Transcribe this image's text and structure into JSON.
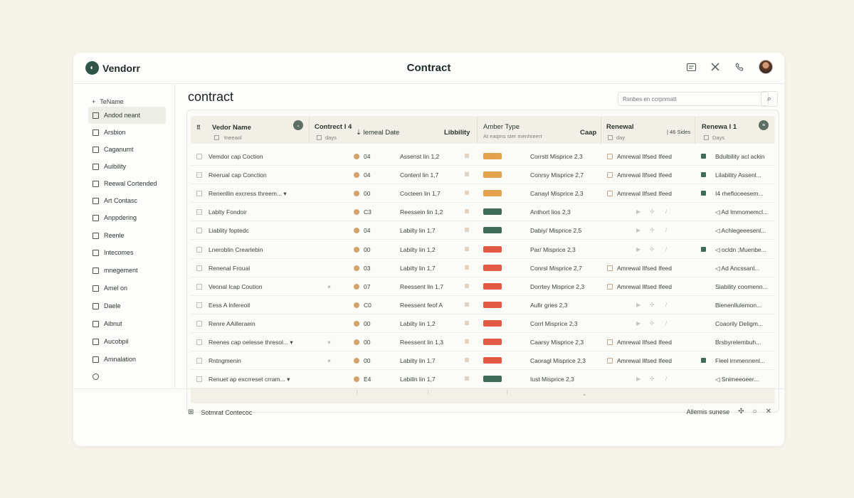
{
  "app": {
    "logo_text": "Vendorr",
    "title": "Contract"
  },
  "colors": {
    "accent": "#2f5548",
    "orange": "#e3a24b",
    "red": "#e25a43",
    "green": "#3f6b5b",
    "background": "#f6f3ea"
  },
  "topbar_icons": [
    "window-icon",
    "tools-icon",
    "phone-icon"
  ],
  "sidebar": {
    "header": "TeName",
    "items": [
      {
        "label": "Andod neant",
        "active": true
      },
      {
        "label": "Arsbion"
      },
      {
        "label": "Caganumt"
      },
      {
        "label": "Auibility"
      },
      {
        "label": "Reewal Cortended"
      },
      {
        "label": "Art Contasc"
      },
      {
        "label": "Anppdering"
      },
      {
        "label": "Reenle"
      },
      {
        "label": "Intecomes"
      },
      {
        "label": "mnegement"
      },
      {
        "label": "Amel on"
      },
      {
        "label": "Daele"
      },
      {
        "label": "Aibnut"
      },
      {
        "label": "Aucobpil"
      },
      {
        "label": "Amnalation"
      },
      {
        "label": ""
      }
    ]
  },
  "page": {
    "title": "contract",
    "search_placeholder": "Rsnbes en ccrpnmatt"
  },
  "table": {
    "headers": {
      "vendor": "Vedor Name",
      "vendor_sub": "tneeaol",
      "contract": "Contrect I 4",
      "contract_sub": "days",
      "renewal_date": "lemeal Date",
      "liability": "Libbility",
      "amber": "Amber Type",
      "amber_sub": "At eaqms ster menhreert",
      "cap": "Caap",
      "renewal": "Renewal",
      "renewal_sub": "day",
      "sides": "46 Sides",
      "renewal2": "Renewa I 1",
      "renewal2_sub": "Days"
    },
    "rows": [
      {
        "vendor": "Vemdor cap Coction",
        "x": "",
        "code": "04",
        "date": "Assenst lin 1,2",
        "status": "orange",
        "type": "Corrstt Misprice 2,3",
        "renewal": "Amrewal Ilfsed Ifeed",
        "last_ico": true,
        "last": "Bdulbility acl ackin"
      },
      {
        "vendor": "Reerual cap Conction",
        "x": "",
        "code": "04",
        "date": "Contenl lin 1,7",
        "status": "orange",
        "type": "Conrsy Misprice 2,7",
        "renewal": "Amrewal Ilfsed Ifeed",
        "last_ico": true,
        "last": "Lilability Assenl..."
      },
      {
        "vendor": "Renenllin excress threem... ▾",
        "x": "",
        "code": "00",
        "date": "Cocteen lin 1,7",
        "status": "orange",
        "type": "Canayl Misprice 2,3",
        "renewal": "Amrewal Ilfsed Ifeed",
        "last_ico": true,
        "last": "I4 rhefloceesem..."
      },
      {
        "vendor": "Lablty Fondoir",
        "x": "",
        "code": "C3",
        "date": "Reessein lin 1,2",
        "status": "green",
        "type": "Anthort lios 2,3",
        "renewal": "",
        "last_ico": false,
        "last": "◁ Ad lmmomemcl..."
      },
      {
        "vendor": "Liablity foptedc",
        "x": "",
        "code": "04",
        "date": "Labilty lin 1,7",
        "status": "green",
        "type": "Dabiy/ Misprice 2,5",
        "renewal": "",
        "last_ico": false,
        "last": "◁ Achlegeeesenl..."
      },
      {
        "vendor": "Lneroblin Crearlebin",
        "x": "",
        "code": "00",
        "date": "Labilty lin 1,2",
        "status": "red",
        "type": "Par/ Misprice 2,3",
        "renewal": "",
        "last_ico": true,
        "last": "◁ ocldn ;Muenbe..."
      },
      {
        "vendor": "Renenal Froual",
        "x": "",
        "code": "03",
        "date": "Labilty lin 1,7",
        "status": "red",
        "type": "Conrsl Misprice 2,7",
        "renewal": "Amrewal Ilfsed Ifeed",
        "last_ico": false,
        "last": "◁ Ad Ancssanl..."
      },
      {
        "vendor": "Veonal lcap Coution",
        "x": "×",
        "code": "07",
        "date": "Reessent lin 1,7",
        "status": "red",
        "type": "Dorrtey Misprice 2,3",
        "renewal": "Amrewal Ilfsed Ifeed",
        "last_ico": false,
        "last": "Siability coomenn..."
      },
      {
        "vendor": "Eess A lnfereoil",
        "x": "",
        "code": "C0",
        "date": "Reessent feof A",
        "status": "red",
        "type": "Aufir gries 2,3",
        "renewal": "",
        "last_ico": false,
        "last": "Bienenllulemon..."
      },
      {
        "vendor": "Renre AAilleraein",
        "x": "",
        "code": "00",
        "date": "Labilty lin 1,2",
        "status": "red",
        "type": "Corrl Misprice 2,3",
        "renewal": "",
        "last_ico": false,
        "last": "Coaorily Deligm..."
      },
      {
        "vendor": "Reenes cap oelesse thresol... ▾",
        "x": "×",
        "code": "00",
        "date": "Reessent lin 1,3",
        "status": "red",
        "type": "Caarsy Misprice 2,3",
        "renewal": "Amrewal Ilfsed Ifeed",
        "last_ico": false,
        "last": "Brsbyrelembuh..."
      },
      {
        "vendor": "Rntngmenin",
        "x": "×",
        "code": "00",
        "date": "Labilty lin 1,7",
        "status": "red",
        "type": "Caoragl Misprice 2,3",
        "renewal": "Amrewal Ilfsed Ifeed",
        "last_ico": true,
        "last": "Fleel irnmennenl..."
      },
      {
        "vendor": "Renuet ap excrreset crram... ▾",
        "x": "",
        "code": "E4",
        "date": "Labilln lin 1,7",
        "status": "green",
        "type": "Iust Misprice 2,3",
        "renewal": "",
        "last_ico": false,
        "last": "◁ Snimeeoeer..."
      }
    ]
  },
  "footer": {
    "left": "Sotmrat Contecoc",
    "right": "Allemis sunese"
  }
}
